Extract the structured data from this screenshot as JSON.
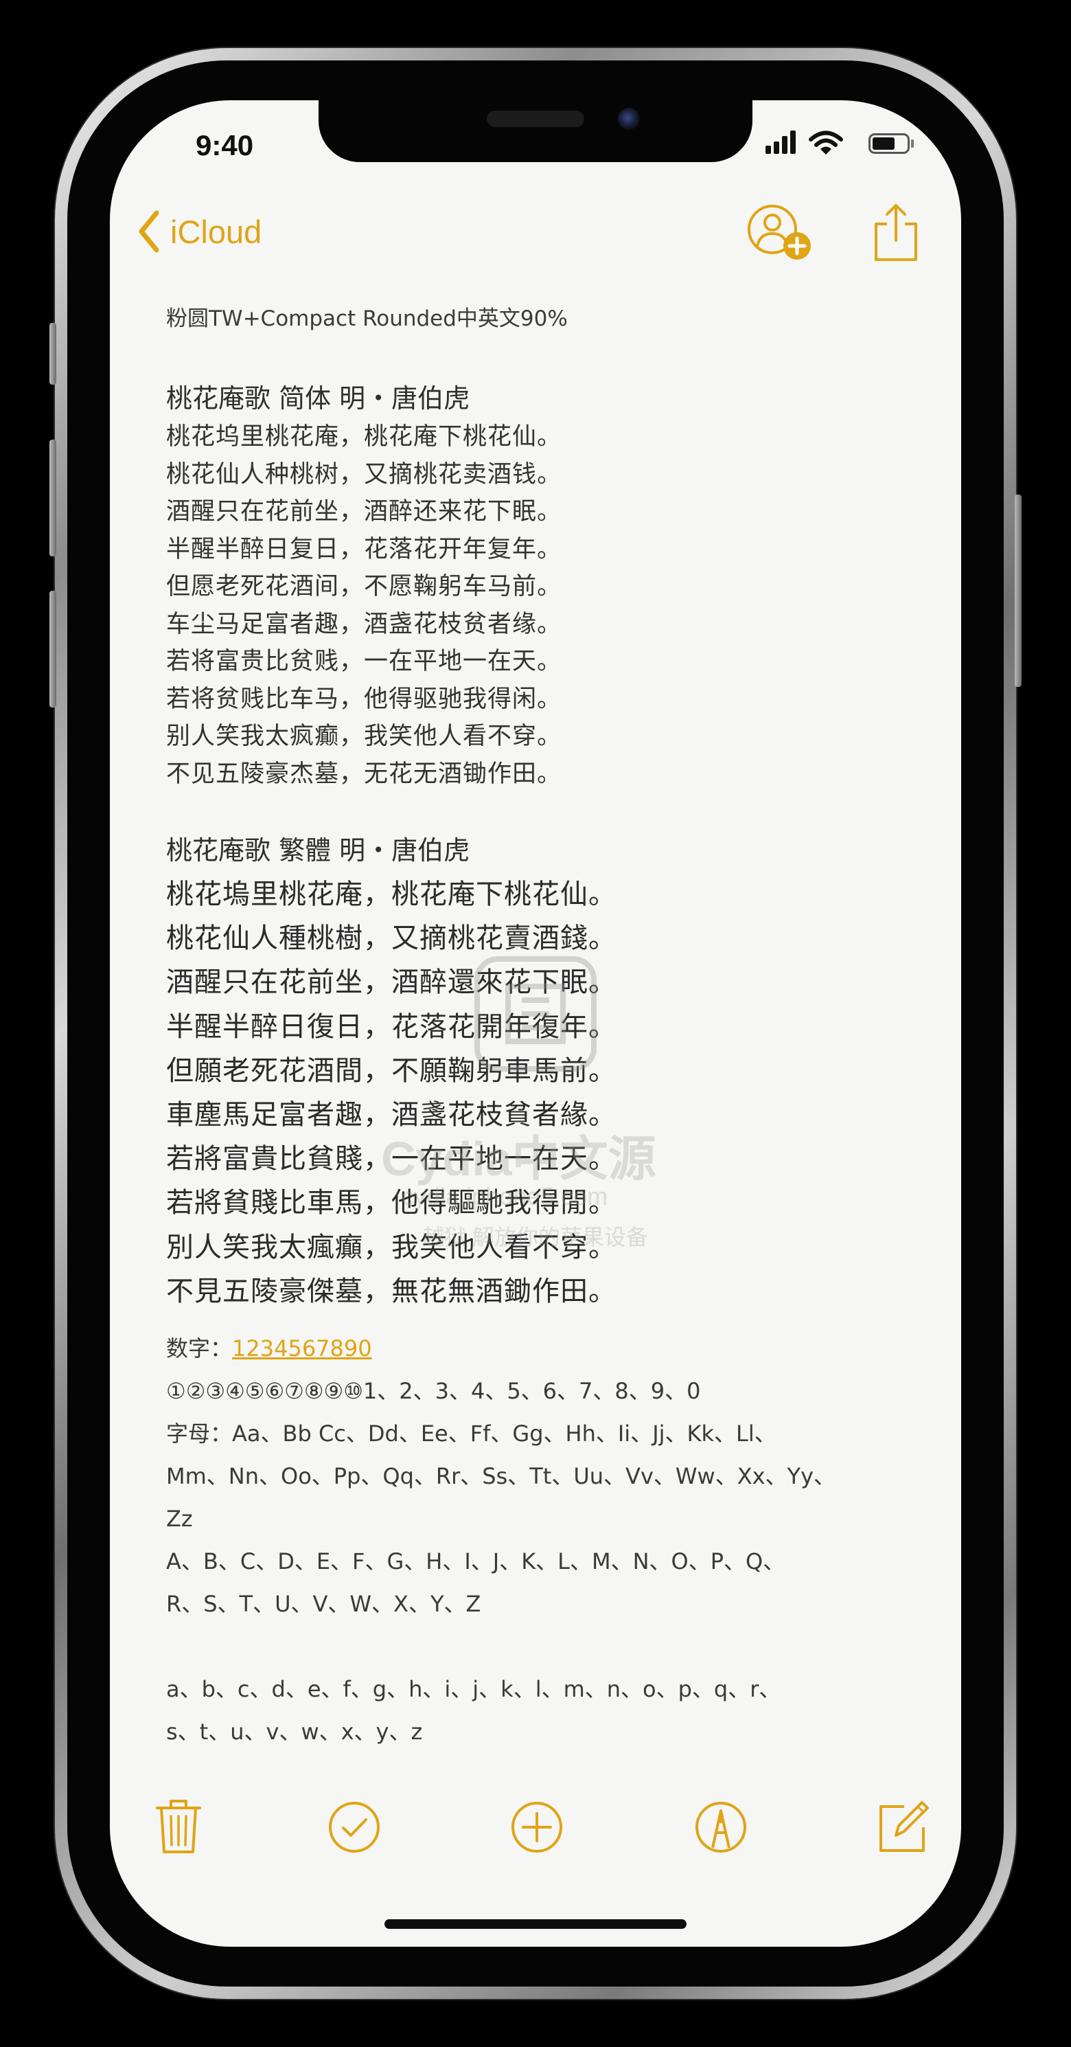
{
  "status_bar": {
    "time": "9:40"
  },
  "nav": {
    "back_label": "iCloud",
    "back_icon": "chevron-left-icon",
    "add_person_icon": "add-person-icon",
    "share_icon": "share-icon"
  },
  "note": {
    "header": "粉圆TW+Compact Rounded中英文90%",
    "simplified_title": "桃花庵歌  简体   明・唐伯虎",
    "simplified_lines": [
      "桃花坞里桃花庵，桃花庵下桃花仙。",
      "桃花仙人种桃树，又摘桃花卖酒钱。",
      "酒醒只在花前坐，酒醉还来花下眠。",
      "半醒半醉日复日，花落花开年复年。",
      "但愿老死花酒间，不愿鞠躬车马前。",
      "车尘马足富者趣，酒盏花枝贫者缘。",
      "若将富贵比贫贱，一在平地一在天。",
      "若将贫贱比车马，他得驱驰我得闲。",
      "别人笑我太疯癫，我笑他人看不穿。",
      "不见五陵豪杰墓，无花无酒锄作田。"
    ],
    "traditional_title": "桃花庵歌  繁體      明・唐伯虎",
    "traditional_lines": [
      "桃花塢里桃花庵，桃花庵下桃花仙。",
      "桃花仙人種桃樹，又摘桃花賣酒錢。",
      "酒醒只在花前坐，酒醉還來花下眠。",
      "半醒半醉日復日，花落花開年復年。",
      "但願老死花酒間，不願鞠躬車馬前。",
      "車塵馬足富者趣，酒盞花枝貧者緣。",
      "若將富貴比貧賤，一在平地一在天。",
      "若將貧賤比車馬，他得驅馳我得閒。",
      "別人笑我太瘋癲，我笑他人看不穿。",
      "不見五陵豪傑墓，無花無酒鋤作田。"
    ],
    "digits_label": "数字：",
    "digits_link": "1234567890",
    "circled_line": "①②③④⑤⑥⑦⑧⑨⑩1、2、3、4、5、6、7、8、9、0",
    "letters_lines": [
      "字母：Aa、Bb Cc、Dd、Ee、Ff、Gg、Hh、Ii、Jj、Kk、Ll、",
      "Mm、Nn、Oo、Pp、Qq、Rr、Ss、Tt、Uu、Vv、Ww、Xx、Yy、",
      "Zz",
      "A、B、C、D、E、F、G、H、I、J、K、L、M、N、O、P、Q、",
      "R、S、T、U、V、W、X、Y、Z"
    ],
    "lowercase_lines": [
      "a、b、c、d、e、f、g、h、i、j、k、l、m、n、o、p、q、r、",
      "s、t、u、v、w、x、y、z"
    ]
  },
  "toolbar": {
    "items": [
      {
        "icon": "trash-icon"
      },
      {
        "icon": "checklist-icon"
      },
      {
        "icon": "add-icon"
      },
      {
        "icon": "markup-icon"
      },
      {
        "icon": "compose-icon"
      }
    ]
  },
  "watermark": {
    "line1": "Cydia中文源",
    "line2": "cydia.iphone5.com",
    "line3": "越狱 解放你的苹果设备"
  },
  "colors": {
    "accent": "#e0a416",
    "background": "#f6f6f4",
    "text": "#2b2b2b"
  }
}
